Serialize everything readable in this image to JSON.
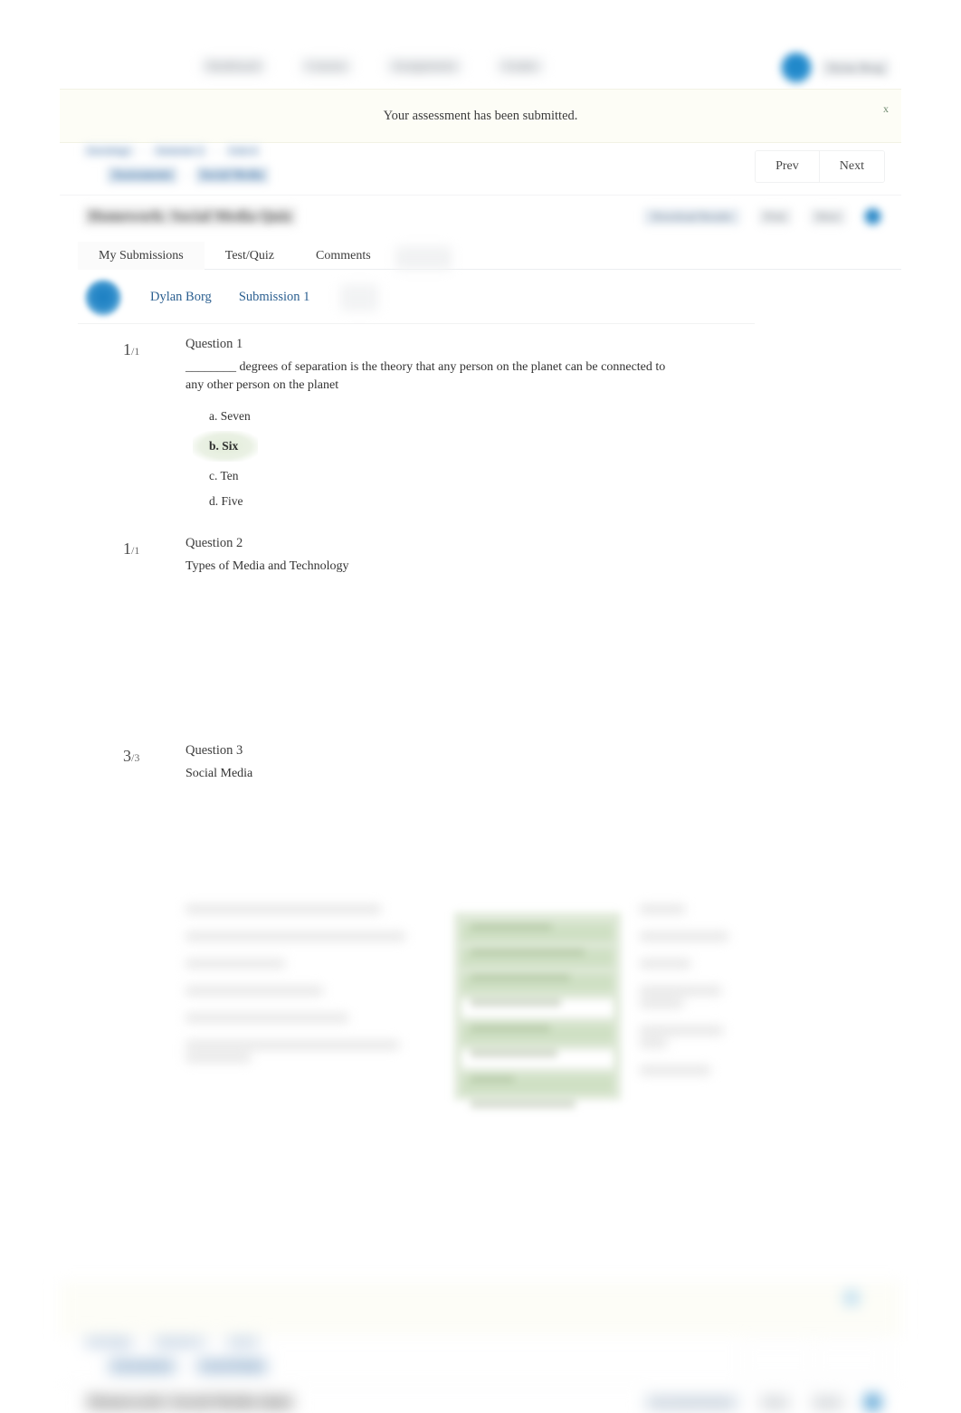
{
  "topnav": {
    "links": [
      "Dashboard",
      "Courses",
      "Assignments",
      "Grades"
    ],
    "user_name": "Dylan Borg",
    "avatar_icon": "user-avatar-icon"
  },
  "notification": {
    "message": "Your assessment has been submitted.",
    "close_label": "x"
  },
  "breadcrumb": {
    "row1": [
      "Sociology",
      "Semester 2",
      "Unit 4"
    ],
    "row2": [
      "Assessments",
      "Social Media"
    ],
    "separator": "›"
  },
  "pager": {
    "prev_label": "Prev",
    "next_label": "Next"
  },
  "assessment": {
    "title": "Homework: Social Media Quiz",
    "toolbar": {
      "download_label": "Download Results",
      "print_label": "Print",
      "more_label": "More",
      "avatar_icon": "status-avatar-icon"
    }
  },
  "tabs": [
    {
      "label": "My Submissions",
      "active": true
    },
    {
      "label": "Test/Quiz",
      "active": false
    },
    {
      "label": "Comments",
      "active": false
    }
  ],
  "submission": {
    "student_name": "Dylan Borg",
    "submission_label": "Submission 1",
    "avatar_icon": "student-avatar-icon"
  },
  "questions": [
    {
      "score": "1",
      "out_of": "/1",
      "label": "Question 1",
      "text": "________ degrees of separation is the theory that any person on the planet can be connected to any other person on the planet",
      "options": [
        {
          "label": "a. Seven",
          "selected": false
        },
        {
          "label": "b. Six",
          "selected": true
        },
        {
          "label": "c. Ten",
          "selected": false
        },
        {
          "label": "d. Five",
          "selected": false
        }
      ]
    },
    {
      "score": "1",
      "out_of": "/1",
      "label": "Question 2",
      "text": "Types of Media and Technology",
      "options": []
    },
    {
      "score": "3",
      "out_of": "/3",
      "label": "Question 3",
      "text": "Social Media",
      "options": []
    }
  ],
  "colors": {
    "link": "#2b5f90",
    "correct_highlight": "#e2ecd9",
    "matching_panel": "#dfe9d8",
    "notification_bg": "#fdfdf6",
    "avatar_blue": "#1f7fc0"
  }
}
